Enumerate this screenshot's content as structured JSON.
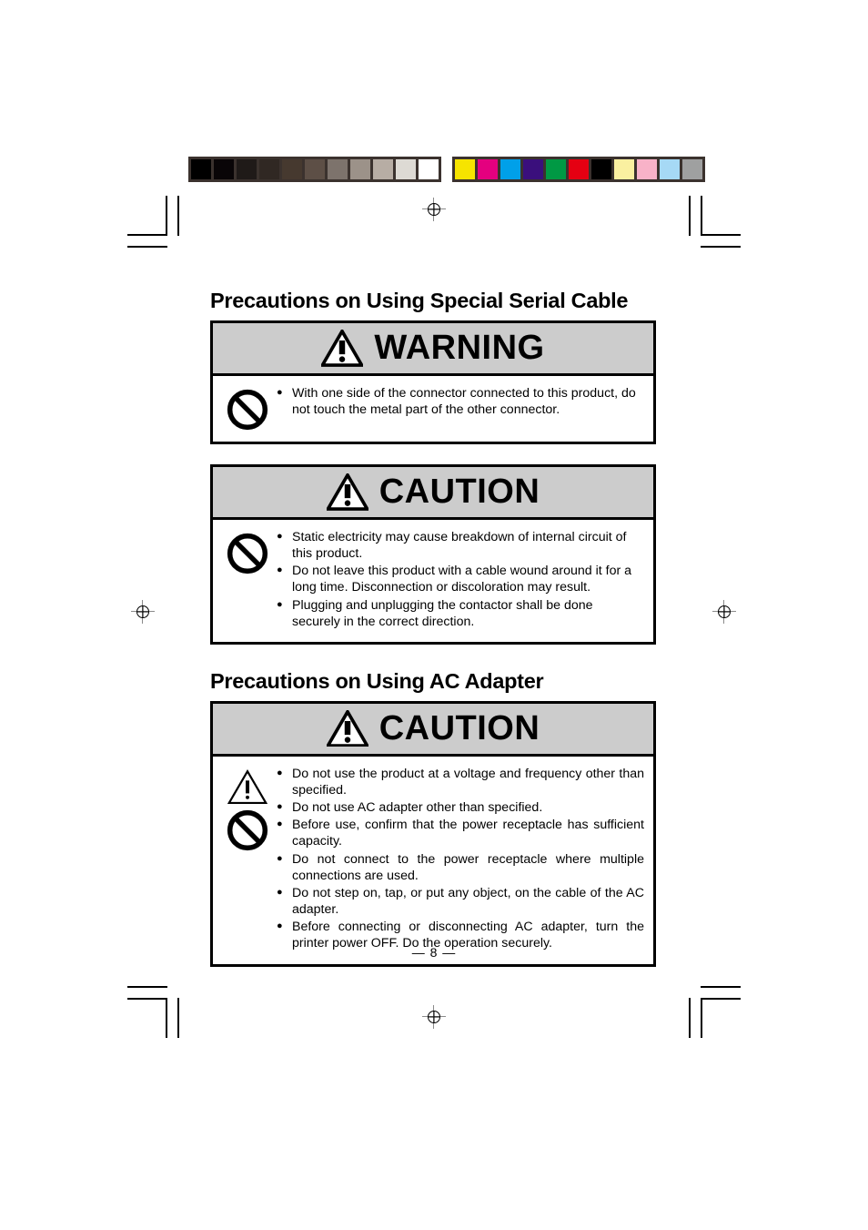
{
  "calibration": {
    "grayscale_strip": {
      "name": "grayscale-calibration-strip",
      "swatches": [
        "#000000",
        "#090507",
        "#1f1a18",
        "#302823",
        "#46392f",
        "#5d4f46",
        "#7d736c",
        "#9c9289",
        "#b7ada4",
        "#dddad4",
        "#ffffff"
      ]
    },
    "color_strip": {
      "name": "color-calibration-strip",
      "swatches": [
        "#f6e400",
        "#e4007f",
        "#00a0e9",
        "#3a0f7c",
        "#009944",
        "#e50012",
        "#000000",
        "#faf0a0",
        "#f8b2c8",
        "#a6d9f5",
        "#9fa0a0"
      ]
    }
  },
  "marks": {
    "registration_target_icon": "registration-target-icon",
    "crop_mark_icon": "crop-mark-icon"
  },
  "sections": [
    {
      "heading": "Precautions on Using Special Serial Cable",
      "boxes": [
        {
          "level": "WARNING",
          "header_label": "WARNING",
          "header_icon": "warning-triangle-icon",
          "header_bg": "#cccccc",
          "icons": [
            "prohibition-icon"
          ],
          "items": [
            "With one side of the connector connected to this product, do not touch the metal part of the other connector."
          ],
          "justified": false
        },
        {
          "level": "CAUTION",
          "header_label": "CAUTION",
          "header_icon": "warning-triangle-icon",
          "header_bg": "#cccccc",
          "icons": [
            "prohibition-icon"
          ],
          "items": [
            "Static electricity may cause breakdown of internal circuit of this product.",
            "Do not leave this product with a cable wound around it for a long time.  Disconnection or discoloration may result.",
            "Plugging and unplugging the contactor shall be done securely in the correct direction."
          ],
          "justified": false
        }
      ]
    },
    {
      "heading": "Precautions on Using AC Adapter",
      "boxes": [
        {
          "level": "CAUTION",
          "header_label": "CAUTION",
          "header_icon": "warning-triangle-icon",
          "header_bg": "#cccccc",
          "icons": [
            "warning-triangle-outline-icon",
            "prohibition-icon"
          ],
          "items": [
            "Do not use the product at a voltage and frequency other than specified.",
            "Do not use AC adapter other than specified.",
            "Before use, confirm that the power receptacle has sufficient capacity.",
            "Do not connect to the power receptacle where multiple connections are used.",
            "Do not step on, tap, or put any object, on the cable of the AC adapter.",
            "Before connecting or disconnecting AC adapter, turn the printer power OFF. Do the operation securely."
          ],
          "justified": true
        }
      ]
    }
  ],
  "footer": {
    "page_number": "— 8 —"
  }
}
